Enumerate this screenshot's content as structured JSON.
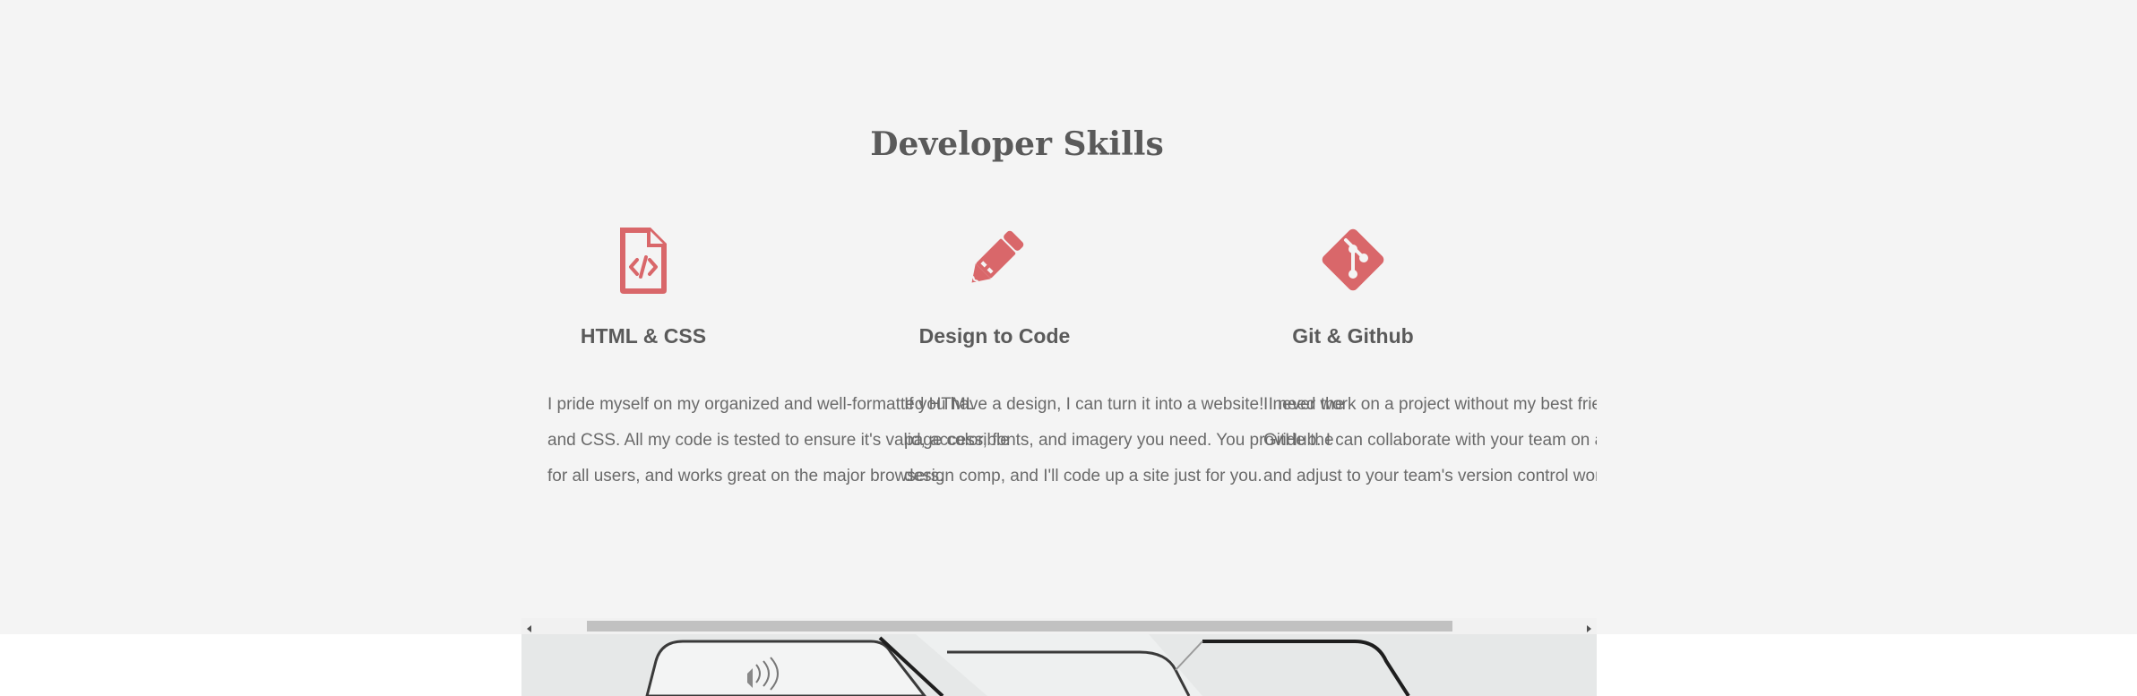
{
  "section": {
    "title": "Developer Skills"
  },
  "cards": [
    {
      "icon": "file-code-icon",
      "title": "HTML & CSS",
      "lines": [
        "I pride myself on my organized and well-formatted HTML",
        "and CSS. All my code is tested to ensure it's valid, accessible",
        "for all users, and works great on the major browsers."
      ]
    },
    {
      "icon": "pencil-icon",
      "title": "Design to Code",
      "lines": [
        "If you have a design, I can turn it into a website! I need the",
        "page color, fonts, and imagery you need. You provide the",
        "design comp, and I'll code up a site just for you."
      ]
    },
    {
      "icon": "git-icon",
      "title": "Git & Github",
      "lines": [
        "I never work on a project without my best friend",
        "GitHub. I can collaborate with your team on a",
        "and adjust to your team's version control workflow."
      ]
    }
  ],
  "colors": {
    "accent": "#d9676a",
    "text": "#5a5a5a",
    "section_bg": "#f4f4f4"
  },
  "scrollbar": {
    "position_fraction": 0.06,
    "visible_fraction": 0.8
  }
}
